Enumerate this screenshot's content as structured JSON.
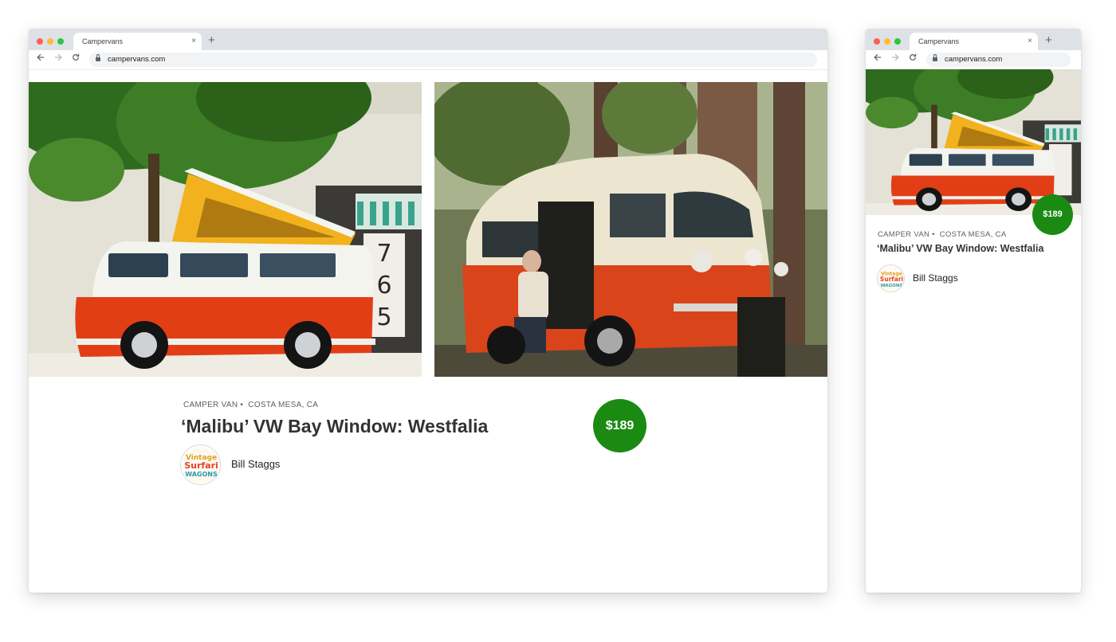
{
  "browser": {
    "tab_title": "Campervans",
    "tab_close": "×",
    "new_tab": "+",
    "url": "campervans.com",
    "back_icon": "arrow-left-icon",
    "forward_icon": "arrow-right-icon",
    "reload_icon": "reload-icon"
  },
  "listing": {
    "category": "CAMPER VAN",
    "separator": "•",
    "location": "COSTA MESA, CA",
    "title": "‘Malibu’ VW Bay Window: Westfalia",
    "price": "$189",
    "host_name": "Bill Staggs",
    "host_avatar_logo_text": "Vintage Surfari Wagons",
    "price_color": "#1a8a12",
    "photos": [
      {
        "alt": "Orange and white VW Westfalia van with pop-top raised, parked under a tree"
      },
      {
        "alt": "Woman sitting in the open door of an orange VW bus in a redwood forest"
      }
    ]
  }
}
